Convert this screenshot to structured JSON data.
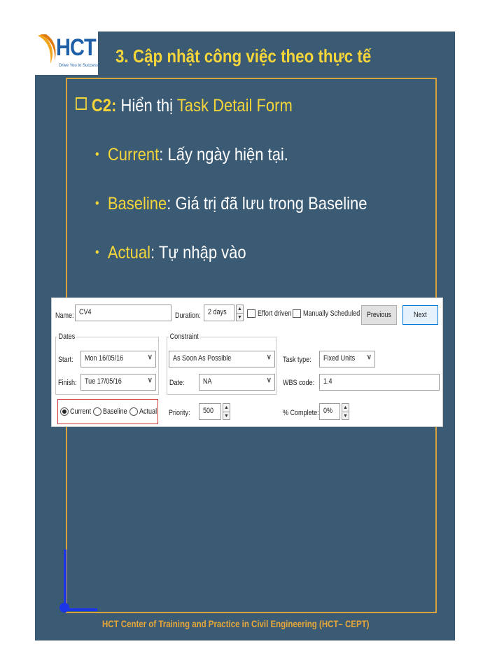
{
  "slide": {
    "logo_text": "HCT",
    "logo_tagline": "Drive You to Success",
    "title": "3. Cập nhật công việc theo thực tế",
    "subtitle": {
      "prefix": "C2:",
      "text": " Hiển thị ",
      "highlight": "Task Detail Form"
    },
    "bullets": [
      {
        "key": "Current",
        "text": ": Lấy ngày hiện tại."
      },
      {
        "key": "Baseline",
        "text": ": Giá trị đã lưu trong Baseline"
      },
      {
        "key": "Actual",
        "text": ": Tự nhập vào"
      }
    ],
    "footer": "HCT Center of Training and Practice in Civil Engineering   (HCT– CEPT)"
  },
  "dialog": {
    "name_label": "Name:",
    "name_value": "CV4",
    "duration_label": "Duration:",
    "duration_value": "2 days",
    "effort_driven": "Effort driven",
    "manually_scheduled": "Manually Scheduled",
    "previous": "Previous",
    "next": "Next",
    "dates_group": "Dates",
    "start_label": "Start:",
    "start_value": "Mon 16/05/16",
    "finish_label": "Finish:",
    "finish_value": "Tue 17/05/16",
    "constraint_group": "Constraint",
    "constraint_value": "As Soon As Possible",
    "date_label": "Date:",
    "date_value": "NA",
    "task_type_label": "Task type:",
    "task_type_value": "Fixed Units",
    "wbs_label": "WBS code:",
    "wbs_value": "1.4",
    "radio_current": "Current",
    "radio_baseline": "Baseline",
    "radio_actual": "Actual",
    "priority_label": "Priority:",
    "priority_value": "500",
    "complete_label": "% Complete:",
    "complete_value": "0%"
  }
}
